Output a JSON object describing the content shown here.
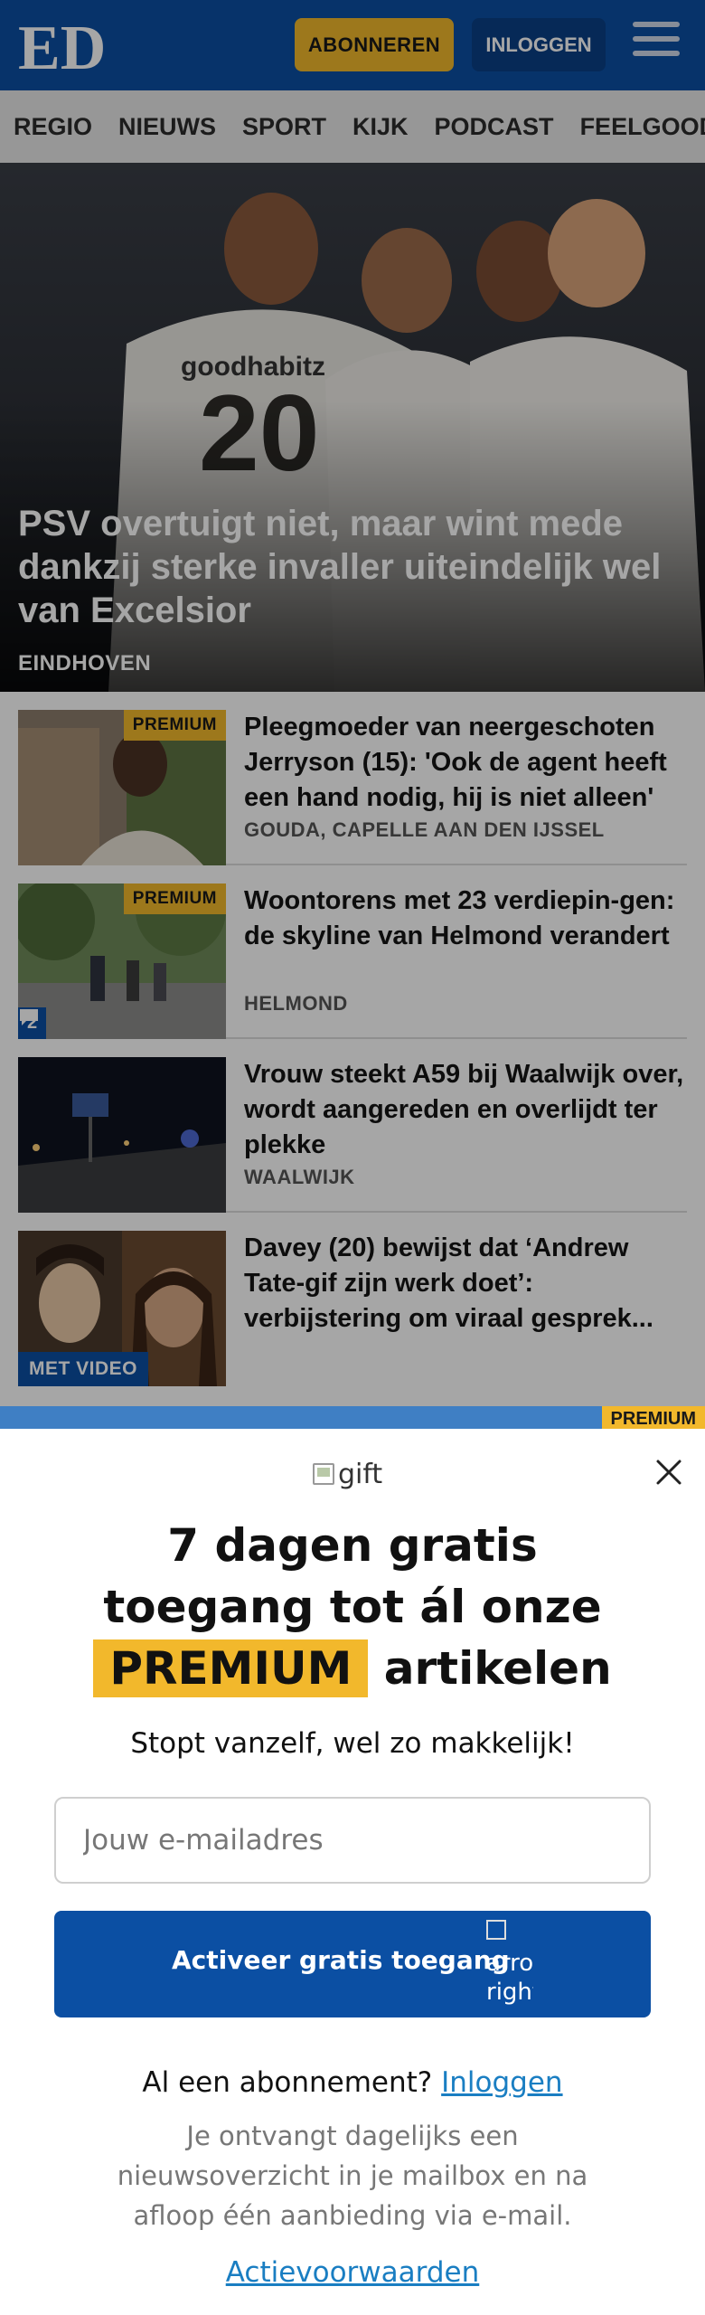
{
  "header": {
    "logo_text": "ED",
    "subscribe_label": "ABONNEREN",
    "login_label": "INLOGGEN",
    "menu_icon": "hamburger-icon"
  },
  "nav": {
    "items": [
      "REGIO",
      "NIEUWS",
      "SPORT",
      "KIJK",
      "PODCAST",
      "FEELGOOD"
    ]
  },
  "hero": {
    "title": "PSV overtuigt niet, maar wint mede dankzij sterke invaller uiteindelijk wel van Excelsior",
    "kicker": "EINDHOVEN",
    "shirt_text": "goodhabitz",
    "shirt_number": "20"
  },
  "articles": [
    {
      "title": "Pleegmoeder van neergeschoten Jerryson (15): 'Ook de agent heeft een hand nodig, hij is niet alleen'",
      "kicker": "GOUDA, CAPELLE AAN DEN IJSSEL",
      "badge": "PREMIUM"
    },
    {
      "title": "Woontorens met 23 verdiepin-gen: de skyline van Helmond verandert",
      "kicker": "HELMOND",
      "badge": "PREMIUM",
      "comments": "2"
    },
    {
      "title": "Vrouw steekt A59 bij Waalwijk over, wordt aangereden en overlijdt ter plekke",
      "kicker": "WAALWIJK"
    },
    {
      "title": "Davey (20) bewijst dat ‘Andrew Tate-gif zijn werk doet’: verbijstering om viraal gesprek...",
      "video_badge": "MET VIDEO"
    }
  ],
  "peek_badge": "PREMIUM",
  "overlay": {
    "gift_alt": "gift",
    "title_line1": "7 dagen gratis",
    "title_line2": "toegang tot ál onze",
    "title_highlight": "PREMIUM",
    "title_line3": "artikelen",
    "subtitle": "Stopt vanzelf, wel zo makkelijk!",
    "email_placeholder": "Jouw e-mailadres",
    "activate_label": "Activeer gratis toegang",
    "arrow_alt": "arrow right",
    "has_subscription": "Al een abonnement?",
    "login_link": "Inloggen",
    "fineprint": "Je ontvangt dagelijks een nieuwsoverzicht in je mailbox en na afloop één aanbieding via e-mail.",
    "terms_link": "Actievoorwaarden"
  },
  "colors": {
    "brand_blue": "#0b4fa3",
    "premium_yellow": "#f2b82c",
    "link_blue": "#1a7ec2"
  }
}
